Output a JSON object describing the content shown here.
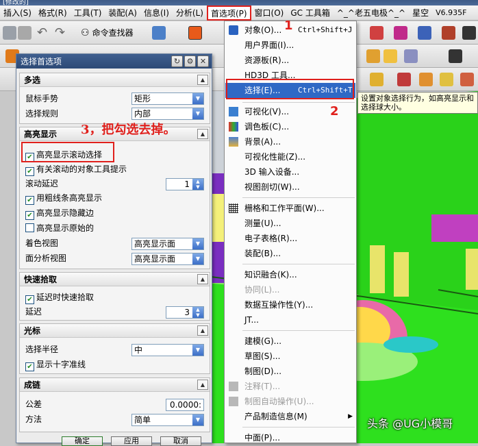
{
  "window": {
    "title": "[修改的]"
  },
  "menubar": {
    "items": [
      {
        "label": "插入(S)"
      },
      {
        "label": "格式(R)"
      },
      {
        "label": "工具(T)"
      },
      {
        "label": "装配(A)"
      },
      {
        "label": "信息(I)"
      },
      {
        "label": "分析(L)"
      },
      {
        "label": "首选项(P)"
      },
      {
        "label": "窗口(O)"
      },
      {
        "label": "GC 工具箱"
      },
      {
        "label": "^_^老五电极^_^"
      },
      {
        "label": "星空"
      },
      {
        "label": "V6.935F"
      }
    ]
  },
  "toolbar": {
    "command_finder_label": "命令查找器"
  },
  "dialog": {
    "title": "选择首选项",
    "sections": {
      "multi_select": {
        "header": "多选",
        "mouse_gesture_label": "鼠标手势",
        "mouse_gesture_value": "矩形",
        "select_rule_label": "选择规则",
        "select_rule_value": "内部"
      },
      "highlight": {
        "header": "高亮显示",
        "rollover_highlight": "高亮显示滚动选择",
        "rollover_tooltip": "有关滚动的对象工具提示",
        "rollover_delay_label": "滚动延迟",
        "rollover_delay_value": "1",
        "thick_lines": "用粗线条高亮显示",
        "highlight_hidden_edges": "高亮显示隐藏边",
        "highlight_original": "高亮显示原始的",
        "shaded_view_label": "着色视图",
        "shaded_view_value": "高亮显示面",
        "face_analysis_label": "面分析视图",
        "face_analysis_value": "高亮显示面"
      },
      "quick_pick": {
        "header": "快速拾取",
        "delay_quick_pick": "延迟时快速拾取",
        "delay_label": "延迟",
        "delay_value": "3"
      },
      "cursor": {
        "header": "光标",
        "radius_label": "选择半径",
        "radius_value": "中",
        "show_crosshair": "显示十字准线"
      },
      "chaining": {
        "header": "成链",
        "tolerance_label": "公差",
        "tolerance_value": "0.0000:",
        "method_label": "方法",
        "method_value": "简单"
      }
    },
    "buttons": {
      "ok": "确定",
      "apply": "应用",
      "cancel": "取消"
    }
  },
  "dropdown": {
    "items": [
      {
        "label": "对象(O)...",
        "shortcut": "Ctrl+Shift+J"
      },
      {
        "label": "用户界面(I)..."
      },
      {
        "label": "资源板(R)..."
      },
      {
        "label": "HD3D 工具..."
      },
      {
        "label": "选择(E)...",
        "shortcut": "Ctrl+Shift+T"
      },
      {
        "label": "可视化(V)..."
      },
      {
        "label": "调色板(C)..."
      },
      {
        "label": "背景(A)..."
      },
      {
        "label": "可视化性能(Z)..."
      },
      {
        "label": "3D 输入设备..."
      },
      {
        "label": "视图剖切(W)..."
      },
      {
        "label": "栅格和工作平面(W)..."
      },
      {
        "label": "测量(U)..."
      },
      {
        "label": "电子表格(R)..."
      },
      {
        "label": "装配(B)..."
      },
      {
        "label": "知识融合(K)..."
      },
      {
        "label": "协同(L)..."
      },
      {
        "label": "数据互操作性(Y)..."
      },
      {
        "label": "JT..."
      },
      {
        "label": "建模(G)..."
      },
      {
        "label": "草图(S)..."
      },
      {
        "label": "制图(D)..."
      },
      {
        "label": "注释(T)..."
      },
      {
        "label": "制图自动操作(U)..."
      },
      {
        "label": "产品制造信息(M)"
      },
      {
        "label": "中面(P)..."
      }
    ]
  },
  "tooltip": {
    "text": "设置对象选择行为，如高亮显示和选择球大小。"
  },
  "annotations": {
    "step1": "1",
    "step2": "2",
    "step3": "3，把勾选去掉。"
  },
  "watermark": "头条 @UG小模哥",
  "colors": {
    "annotation": "#e0201c",
    "highlight": "#2f69c5",
    "title_bar": "#2d4a76"
  }
}
